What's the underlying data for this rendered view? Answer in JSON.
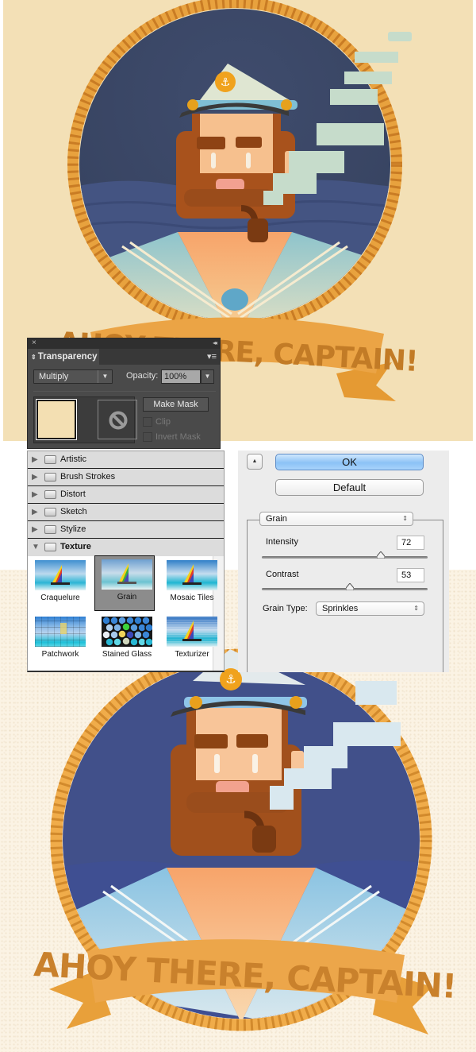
{
  "artwork": {
    "banner_text": "AHOY THERE, CAPTAIN!",
    "colors": {
      "background_top": "#f3e0b6",
      "background_bottom": "#fbf3e4",
      "night_sky": "#3d4a6b",
      "sea": "#445482",
      "rope": "#e8a23e",
      "banner": "#eba445",
      "banner_text": "#c27b26",
      "beard": "#a8521c",
      "skin": "#f6c08e",
      "hat": "#dfe6d2",
      "anchor_badge": "#f0a21d",
      "smoke": "#c6dccb",
      "collar": "#7fb3c7"
    }
  },
  "transparency_panel": {
    "title": "Transparency",
    "close_glyph": "×",
    "collapse_glyph": "◂◂",
    "menu_glyph": "▾≡",
    "blend_mode": "Multiply",
    "opacity_label": "Opacity:",
    "opacity_value": "100%",
    "make_mask_label": "Make Mask",
    "clip_label": "Clip",
    "invert_mask_label": "Invert Mask",
    "clip_checked": false,
    "invert_mask_checked": false,
    "swatch_color": "#f3dfb2"
  },
  "filter_gallery": {
    "categories": [
      {
        "label": "Artistic",
        "expanded": false
      },
      {
        "label": "Brush Strokes",
        "expanded": false
      },
      {
        "label": "Distort",
        "expanded": false
      },
      {
        "label": "Sketch",
        "expanded": false
      },
      {
        "label": "Stylize",
        "expanded": false
      },
      {
        "label": "Texture",
        "expanded": true
      }
    ],
    "texture_filters": [
      {
        "label": "Craquelure",
        "selected": false
      },
      {
        "label": "Grain",
        "selected": true
      },
      {
        "label": "Mosaic Tiles",
        "selected": false
      },
      {
        "label": "Patchwork",
        "selected": false
      },
      {
        "label": "Stained Glass",
        "selected": false
      },
      {
        "label": "Texturizer",
        "selected": false
      }
    ],
    "ok_label": "OK",
    "default_label": "Default",
    "selected_filter": "Grain",
    "settings": {
      "intensity_label": "Intensity",
      "intensity_value": "72",
      "intensity_fraction": 0.72,
      "contrast_label": "Contrast",
      "contrast_value": "53",
      "contrast_fraction": 0.53,
      "grain_type_label": "Grain Type:",
      "grain_type_value": "Sprinkles"
    }
  }
}
